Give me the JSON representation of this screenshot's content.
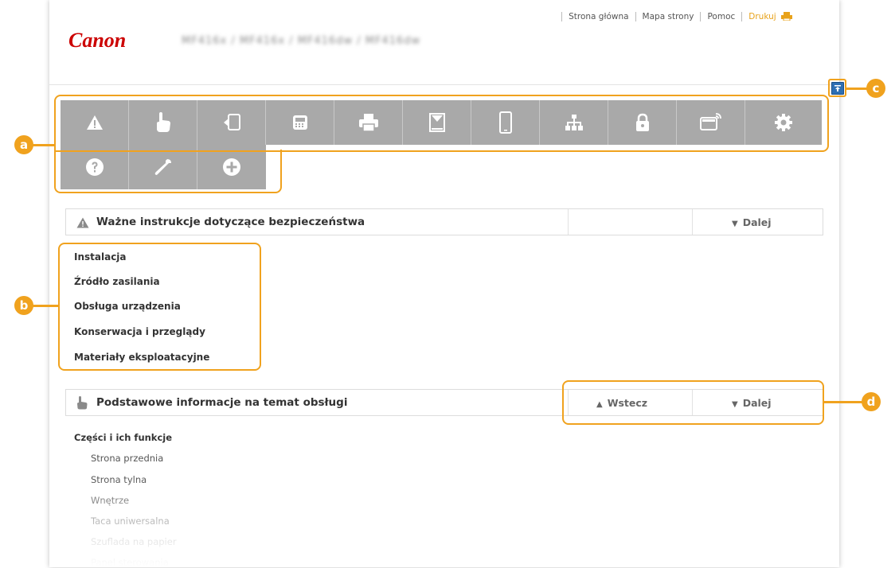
{
  "header": {
    "logo": "Canon",
    "model": "MF416x / MF416x / MF416dw / MF416dw",
    "links": [
      "Strona główna",
      "Mapa strony",
      "Pomoc"
    ],
    "print_label": "Drukuj"
  },
  "toolbar": {
    "icons": [
      "warning-icon",
      "hand-pointer-icon",
      "copy-icon",
      "fax-icon",
      "printer-icon",
      "scanner-icon",
      "mobile-icon",
      "network-icon",
      "lock-icon",
      "remote-ui-icon",
      "settings-gear-icon",
      "help-question-icon",
      "wrench-icon",
      "plus-circle-icon"
    ]
  },
  "section1": {
    "title": "Ważne instrukcje dotyczące bezpieczeństwa",
    "next_label": "Dalej",
    "items": [
      "Instalacja",
      "Źródło zasilania",
      "Obsługa urządzenia",
      "Konserwacja i przeglądy",
      "Materiały eksploatacyjne"
    ]
  },
  "section2": {
    "title": "Podstawowe informacje na temat obsługi",
    "back_label": "Wstecz",
    "next_label": "Dalej",
    "group_title": "Części i ich funkcje",
    "sub_items": [
      "Strona przednia",
      "Strona tylna",
      "Wnętrze",
      "Taca uniwersalna",
      "Szuflada na papier",
      "Panel sterowania"
    ]
  },
  "callouts": [
    "a",
    "b",
    "c",
    "d"
  ],
  "colors": {
    "accent_callout": "#f0a21e",
    "logo_red": "#cc0000",
    "print_link": "#e8a21a",
    "toolbar_gray": "#a9a9a9",
    "collapse_blue": "#2d6fb4"
  }
}
